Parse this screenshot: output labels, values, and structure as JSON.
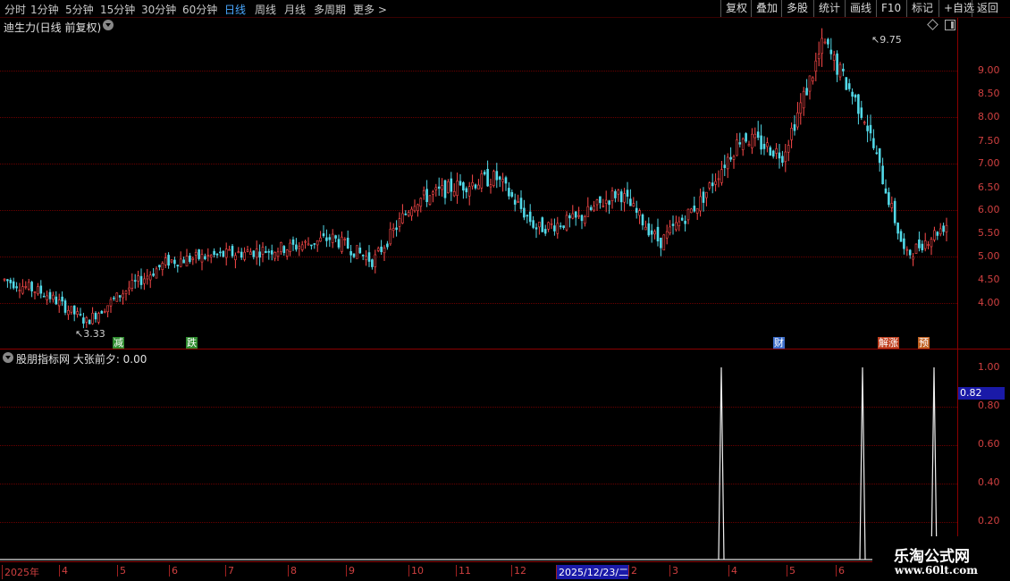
{
  "toolbar": {
    "periods": [
      "分时",
      "1分钟",
      "5分钟",
      "15分钟",
      "30分钟",
      "60分钟",
      "日线",
      "周线",
      "月线",
      "多周期",
      "更多 >"
    ],
    "active": "日线",
    "right_buttons": [
      "复权",
      "叠加",
      "多股",
      "统计",
      "画线",
      "F10",
      "标记",
      "+自选",
      "返回"
    ]
  },
  "main_panel": {
    "title": "迪生力(日线 前复权)",
    "max_label": "9.75",
    "min_label": "3.33",
    "y_ticks": [
      "9.00",
      "8.50",
      "8.00",
      "7.50",
      "7.00",
      "6.50",
      "6.00",
      "5.50",
      "5.00",
      "4.50",
      "4.00"
    ],
    "event_tags": [
      {
        "text": "减",
        "color": "#2e8b2e"
      },
      {
        "text": "跌",
        "color": "#2e8b2e"
      },
      {
        "text": "财",
        "color": "#3a6bc8"
      },
      {
        "text": "解涨",
        "color": "#c04020"
      },
      {
        "text": "预",
        "color": "#c06020"
      }
    ]
  },
  "indicator_panel": {
    "title": "股朋指标网 大张前夕: 0.00",
    "y_ticks": [
      "1.00",
      "0.80",
      "0.60",
      "0.40",
      "0.20"
    ],
    "cursor_value": "0.82"
  },
  "date_axis": {
    "labels": [
      "2025年",
      "4",
      "5",
      "6",
      "7",
      "8",
      "9",
      "10",
      "11",
      "12",
      "2025/12/23/二",
      "2",
      "3",
      "4",
      "5",
      "6"
    ]
  },
  "watermark": {
    "title": "乐淘公式网",
    "url": "www.60lt.com"
  },
  "chart_data": [
    {
      "type": "candlestick",
      "title": "迪生力(日线 前复权)",
      "ylim": [
        3.3,
        9.9
      ],
      "annotations": {
        "high": 9.75,
        "low": 3.33
      },
      "approx_close_path": [
        {
          "date": "2025-01",
          "close": 4.5
        },
        {
          "date": "2025-02",
          "close": 4.2
        },
        {
          "date": "2025-02",
          "close": 3.6
        },
        {
          "date": "2025-03",
          "close": 4.3
        },
        {
          "date": "2025-04",
          "close": 4.9
        },
        {
          "date": "2025-05",
          "close": 5.0
        },
        {
          "date": "2025-06",
          "close": 5.1
        },
        {
          "date": "2025-07",
          "close": 5.2
        },
        {
          "date": "2025-08",
          "close": 5.4
        },
        {
          "date": "2025-08",
          "close": 4.9
        },
        {
          "date": "2025-09",
          "close": 6.2
        },
        {
          "date": "2025-10",
          "close": 6.5
        },
        {
          "date": "2025-11",
          "close": 6.7
        },
        {
          "date": "2025-11",
          "close": 5.6
        },
        {
          "date": "2025-12",
          "close": 5.8
        },
        {
          "date": "2026-01",
          "close": 6.4
        },
        {
          "date": "2026-02",
          "close": 5.3
        },
        {
          "date": "2026-03",
          "close": 6.2
        },
        {
          "date": "2026-04",
          "close": 7.6
        },
        {
          "date": "2026-05",
          "close": 7.2
        },
        {
          "date": "2026-05",
          "close": 9.6
        },
        {
          "date": "2026-06",
          "close": 8.0
        },
        {
          "date": "2026-06",
          "close": 5.0
        },
        {
          "date": "2026-06",
          "close": 5.7
        }
      ]
    },
    {
      "type": "line",
      "title": "股朋指标网 大张前夕",
      "ylim": [
        0,
        1.0
      ],
      "series": [
        {
          "name": "大张前夕",
          "spikes": [
            1.0,
            1.0,
            1.0
          ]
        }
      ]
    }
  ]
}
